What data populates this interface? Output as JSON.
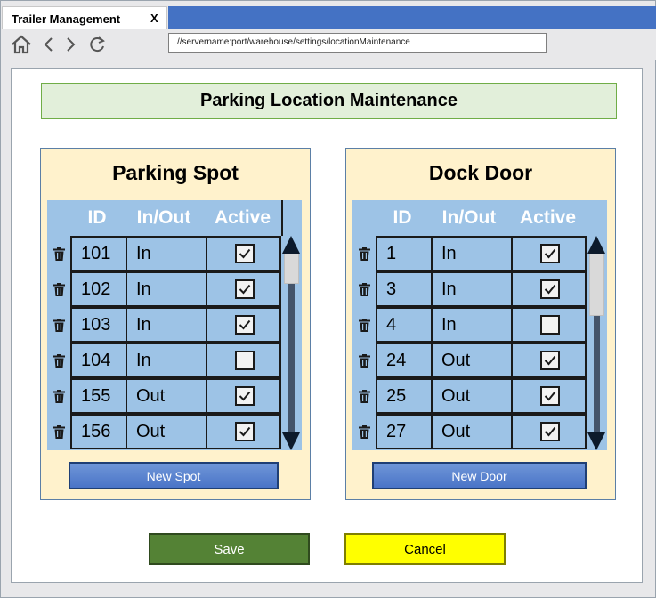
{
  "window": {
    "tab_title": "Trailer Management",
    "tab_close": "X"
  },
  "nav": {
    "address": "//servername:port/warehouse/settings/locationMaintenance"
  },
  "page": {
    "title": "Parking Location Maintenance"
  },
  "colors": {
    "accent": "#4472c4",
    "save": "#548235",
    "cancel": "#ffff00",
    "panel_bg": "#fff2cc",
    "grid_bg": "#9dc3e6"
  },
  "parking": {
    "title": "Parking Spot",
    "headers": {
      "id": "ID",
      "io": "In/Out",
      "active": "Active"
    },
    "rows": [
      {
        "id": "101",
        "io": "In",
        "active": true
      },
      {
        "id": "102",
        "io": "In",
        "active": true
      },
      {
        "id": "103",
        "io": "In",
        "active": true
      },
      {
        "id": "104",
        "io": "In",
        "active": false
      },
      {
        "id": "155",
        "io": "Out",
        "active": true
      },
      {
        "id": "156",
        "io": "Out",
        "active": true
      }
    ],
    "new_label": "New Spot"
  },
  "dock": {
    "title": "Dock Door",
    "headers": {
      "id": "ID",
      "io": "In/Out",
      "active": "Active"
    },
    "rows": [
      {
        "id": "1",
        "io": "In",
        "active": true
      },
      {
        "id": "3",
        "io": "In",
        "active": true
      },
      {
        "id": "4",
        "io": "In",
        "active": false
      },
      {
        "id": "24",
        "io": "Out",
        "active": true
      },
      {
        "id": "25",
        "io": "Out",
        "active": true
      },
      {
        "id": "27",
        "io": "Out",
        "active": true
      }
    ],
    "new_label": "New Door"
  },
  "actions": {
    "save_label": "Save",
    "cancel_label": "Cancel"
  }
}
